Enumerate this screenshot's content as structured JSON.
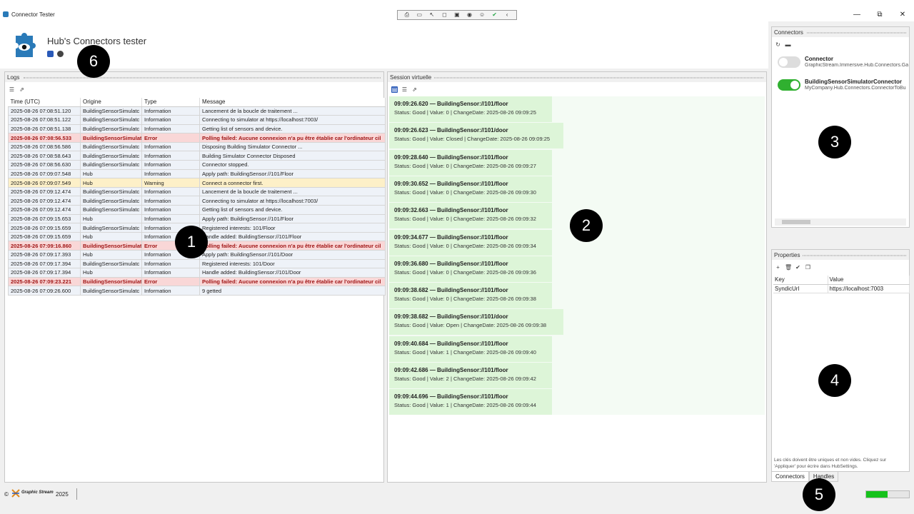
{
  "window": {
    "title": "Connector Tester",
    "controls": [
      "—",
      "⧉",
      "✕"
    ]
  },
  "toolbar_icons": [
    "capture-icon",
    "video-icon",
    "cursor-icon",
    "frame-icon",
    "screen-icon",
    "broadcast-icon",
    "accessibility-icon",
    "check-icon",
    "back-icon"
  ],
  "header": {
    "title": "Hub's Connectors tester"
  },
  "markers": [
    "1",
    "2",
    "3",
    "4",
    "5",
    "6"
  ],
  "logs": {
    "title": "Logs",
    "columns": [
      "Time (UTC)",
      "Origine",
      "Type",
      "Message"
    ],
    "rows": [
      {
        "time": "2025-08-26 07:08:51.120",
        "origin": "BuildingSensorSimulatc",
        "type": "Information",
        "message": "Lancement de la boucle de traitement ...",
        "level": "info"
      },
      {
        "time": "2025-08-26 07:08:51.122",
        "origin": "BuildingSensorSimulatc",
        "type": "Information",
        "message": "Connecting to simulator at https://localhost:7003/",
        "level": "info"
      },
      {
        "time": "2025-08-26 07:08:51.138",
        "origin": "BuildingSensorSimulatc",
        "type": "Information",
        "message": "Getting list of sensors and device.",
        "level": "info"
      },
      {
        "time": "2025-08-26 07:08:56.533",
        "origin": "BuildingSensorSimulat",
        "type": "Error",
        "message": "Polling failed: Aucune connexion n'a pu être établie car l'ordinateur cil",
        "level": "error"
      },
      {
        "time": "2025-08-26 07:08:56.586",
        "origin": "BuildingSensorSimulatc",
        "type": "Information",
        "message": "Disposing Building Simulator Connector ...",
        "level": "info"
      },
      {
        "time": "2025-08-26 07:08:58.643",
        "origin": "BuildingSensorSimulatc",
        "type": "Information",
        "message": "Building Simulator Connector Disposed",
        "level": "info"
      },
      {
        "time": "2025-08-26 07:08:56.630",
        "origin": "BuildingSensorSimulatc",
        "type": "Information",
        "message": "Connector stopped.",
        "level": "info"
      },
      {
        "time": "2025-08-26 07:09:07.548",
        "origin": "Hub",
        "type": "Information",
        "message": "Apply path: BuildingSensor://101/Floor",
        "level": "info"
      },
      {
        "time": "2025-08-26 07:09:07.549",
        "origin": "Hub",
        "type": "Warning",
        "message": "Connect a connector first.",
        "level": "warn"
      },
      {
        "time": "2025-08-26 07:09:12.474",
        "origin": "BuildingSensorSimulatc",
        "type": "Information",
        "message": "Lancement de la boucle de traitement ...",
        "level": "info"
      },
      {
        "time": "2025-08-26 07:09:12.474",
        "origin": "BuildingSensorSimulatc",
        "type": "Information",
        "message": "Connecting to simulator at https://localhost:7003/",
        "level": "info"
      },
      {
        "time": "2025-08-26 07:09:12.474",
        "origin": "BuildingSensorSimulatc",
        "type": "Information",
        "message": "Getting list of sensors and device.",
        "level": "info"
      },
      {
        "time": "2025-08-26 07:09:15.653",
        "origin": "Hub",
        "type": "Information",
        "message": "Apply path: BuildingSensor://101/Floor",
        "level": "info"
      },
      {
        "time": "2025-08-26 07:09:15.659",
        "origin": "BuildingSensorSimulatc",
        "type": "Information",
        "message": "Registered interests: 101/Floor",
        "level": "info"
      },
      {
        "time": "2025-08-26 07:09:15.659",
        "origin": "Hub",
        "type": "Information",
        "message": "Handle added: BuildingSensor://101/Floor",
        "level": "info"
      },
      {
        "time": "2025-08-26 07:09:16.860",
        "origin": "BuildingSensorSimulat",
        "type": "Error",
        "message": "Polling failed: Aucune connexion n'a pu être établie car l'ordinateur cil",
        "level": "error"
      },
      {
        "time": "2025-08-26 07:09:17.393",
        "origin": "Hub",
        "type": "Information",
        "message": "Apply path: BuildingSensor://101/Door",
        "level": "info"
      },
      {
        "time": "2025-08-26 07:09:17.394",
        "origin": "BuildingSensorSimulatc",
        "type": "Information",
        "message": "Registered interests: 101/Door",
        "level": "info"
      },
      {
        "time": "2025-08-26 07:09:17.394",
        "origin": "Hub",
        "type": "Information",
        "message": "Handle added: BuildingSensor://101/Door",
        "level": "info"
      },
      {
        "time": "2025-08-26 07:09:23.221",
        "origin": "BuildingSensorSimulat",
        "type": "Error",
        "message": "Polling failed: Aucune connexion n'a pu être établie car l'ordinateur cil",
        "level": "error"
      },
      {
        "time": "2025-08-26 07:09:26.600",
        "origin": "BuildingSensorSimulatc",
        "type": "Information",
        "message": "9 getted",
        "level": "info"
      }
    ]
  },
  "session": {
    "title": "Session virtuelle",
    "entries": [
      {
        "head": "09:09:26.620  —  BuildingSensor://101/floor",
        "detail": "Status: Good   |  Value: 0   |  ChangeDate: 2025-08-26 09:09:25"
      },
      {
        "head": "09:09:26.623  —  BuildingSensor://101/door",
        "detail": "Status: Good   |  Value: Closed   |  ChangeDate: 2025-08-26 09:09:25"
      },
      {
        "head": "09:09:28.640  —  BuildingSensor://101/floor",
        "detail": "Status: Good   |  Value: 0   |  ChangeDate: 2025-08-26 09:09:27"
      },
      {
        "head": "09:09:30.652  —  BuildingSensor://101/floor",
        "detail": "Status: Good   |  Value: 0   |  ChangeDate: 2025-08-26 09:09:30"
      },
      {
        "head": "09:09:32.663  —  BuildingSensor://101/floor",
        "detail": "Status: Good   |  Value: 0   |  ChangeDate: 2025-08-26 09:09:32"
      },
      {
        "head": "09:09:34.677  —  BuildingSensor://101/floor",
        "detail": "Status: Good   |  Value: 0   |  ChangeDate: 2025-08-26 09:09:34"
      },
      {
        "head": "09:09:36.680  —  BuildingSensor://101/floor",
        "detail": "Status: Good   |  Value: 0   |  ChangeDate: 2025-08-26 09:09:36"
      },
      {
        "head": "09:09:38.682  —  BuildingSensor://101/floor",
        "detail": "Status: Good   |  Value: 0   |  ChangeDate: 2025-08-26 09:09:38"
      },
      {
        "head": "09:09:38.682  —  BuildingSensor://101/door",
        "detail": "Status: Good   |  Value: Open   |  ChangeDate: 2025-08-26 09:09:38"
      },
      {
        "head": "09:09:40.684  —  BuildingSensor://101/floor",
        "detail": "Status: Good   |  Value: 1   |  ChangeDate: 2025-08-26 09:09:40"
      },
      {
        "head": "09:09:42.686  —  BuildingSensor://101/floor",
        "detail": "Status: Good   |  Value: 2   |  ChangeDate: 2025-08-26 09:09:42"
      },
      {
        "head": "09:09:44.696  —  BuildingSensor://101/floor",
        "detail": "Status: Good   |  Value: 1   |  ChangeDate: 2025-08-26 09:09:44"
      }
    ]
  },
  "connectors": {
    "title": "Connectors",
    "items": [
      {
        "name": "Connector",
        "namespace": "GraphicStream.Immersive.Hub.Connectors.Ga",
        "enabled": false
      },
      {
        "name": "BuildingSensorSimulatorConnector",
        "namespace": "MyCompany.Hub.Connectors.ConnectorToBu",
        "enabled": true
      }
    ]
  },
  "properties": {
    "title": "Properties",
    "columns": [
      "Key",
      "Value"
    ],
    "rows": [
      {
        "key": "SyndicUrl",
        "value": "https://localhost:7003"
      }
    ],
    "hint": "Les clés doivent être uniques et non vides. Cliquez sur 'Appliquer' pour écrire dans HubSettings.",
    "tabs": [
      "Connectors",
      "Handles"
    ]
  },
  "statusbar": {
    "copyright": "©",
    "brand": "Graphic Stream",
    "year": "2025",
    "progress": 0.5
  },
  "colors": {
    "accent": "#2a5ab8",
    "toggle_on": "#30b030",
    "error_row": "#f9d7d7",
    "warn_row": "#fdf0c8",
    "session_card": "#ddf5d8",
    "progress": "#16c21c"
  }
}
